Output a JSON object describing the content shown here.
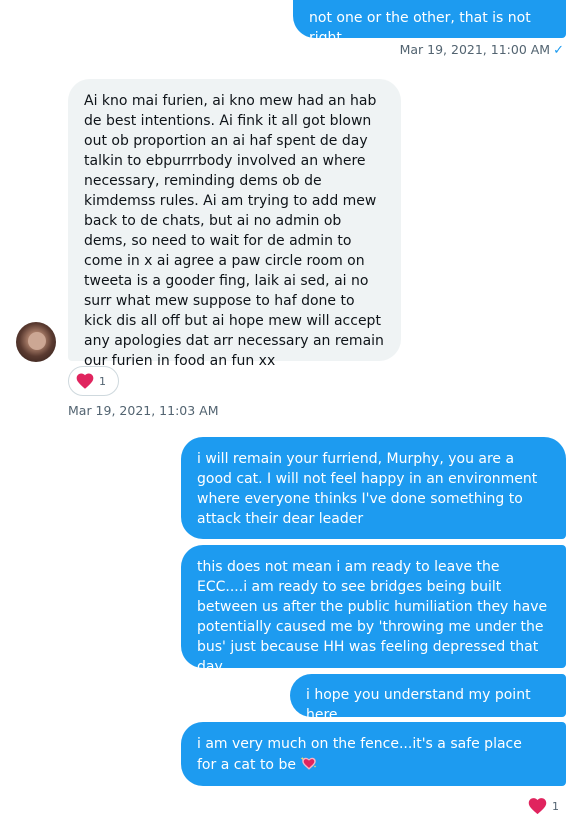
{
  "messages": [
    {
      "text": "not one or the other, that is not right"
    },
    {
      "text": "Ai kno mai furien, ai kno mew had an hab de best intentions. Ai fink it all got blown out ob proportion an ai haf spent de day talkin to ebpurrrbody involved an where necessary, reminding dems ob de kimdemss rules. Ai am trying to add mew back to de chats, but ai no admin ob dems, so need to wait for de admin to come in x ai agree a paw circle room on tweeta is a gooder fing, laik ai sed, ai no surr what mew suppose to haf done to kick dis all off but ai hope mew will accept any apologies dat arr necessary an remain our furien in food an fun xx"
    },
    {
      "text": "i will remain your furriend, Murphy, you are a good cat. I will not feel happy in an environment where everyone thinks I've done something to attack their dear leader"
    },
    {
      "text": "this does not mean i am ready to leave the ECC....i am ready to see bridges being built between us after the public humiliation they have potentially caused me by 'throwing me under the bus' just because HH was feeling depressed that day"
    },
    {
      "text": "i hope you understand my point here"
    },
    {
      "text": "i am very much on the fence...it's a safe place for a cat to be"
    }
  ],
  "timestamps": {
    "sent_1": "Mar 19, 2021, 11:00 AM",
    "received_1": "Mar 19, 2021, 11:03 AM"
  },
  "reactions": {
    "received_count": "1",
    "sent_count": "1"
  },
  "icons": {
    "read_receipt": "checkmark-icon",
    "reaction": "red-heart-icon",
    "inline_emoji": "sparkling-heart-icon"
  },
  "colors": {
    "sent_bubble": "#1d9bf0",
    "received_bubble": "#eff3f4",
    "meta_text": "#536471",
    "heart": "#e0245e"
  }
}
